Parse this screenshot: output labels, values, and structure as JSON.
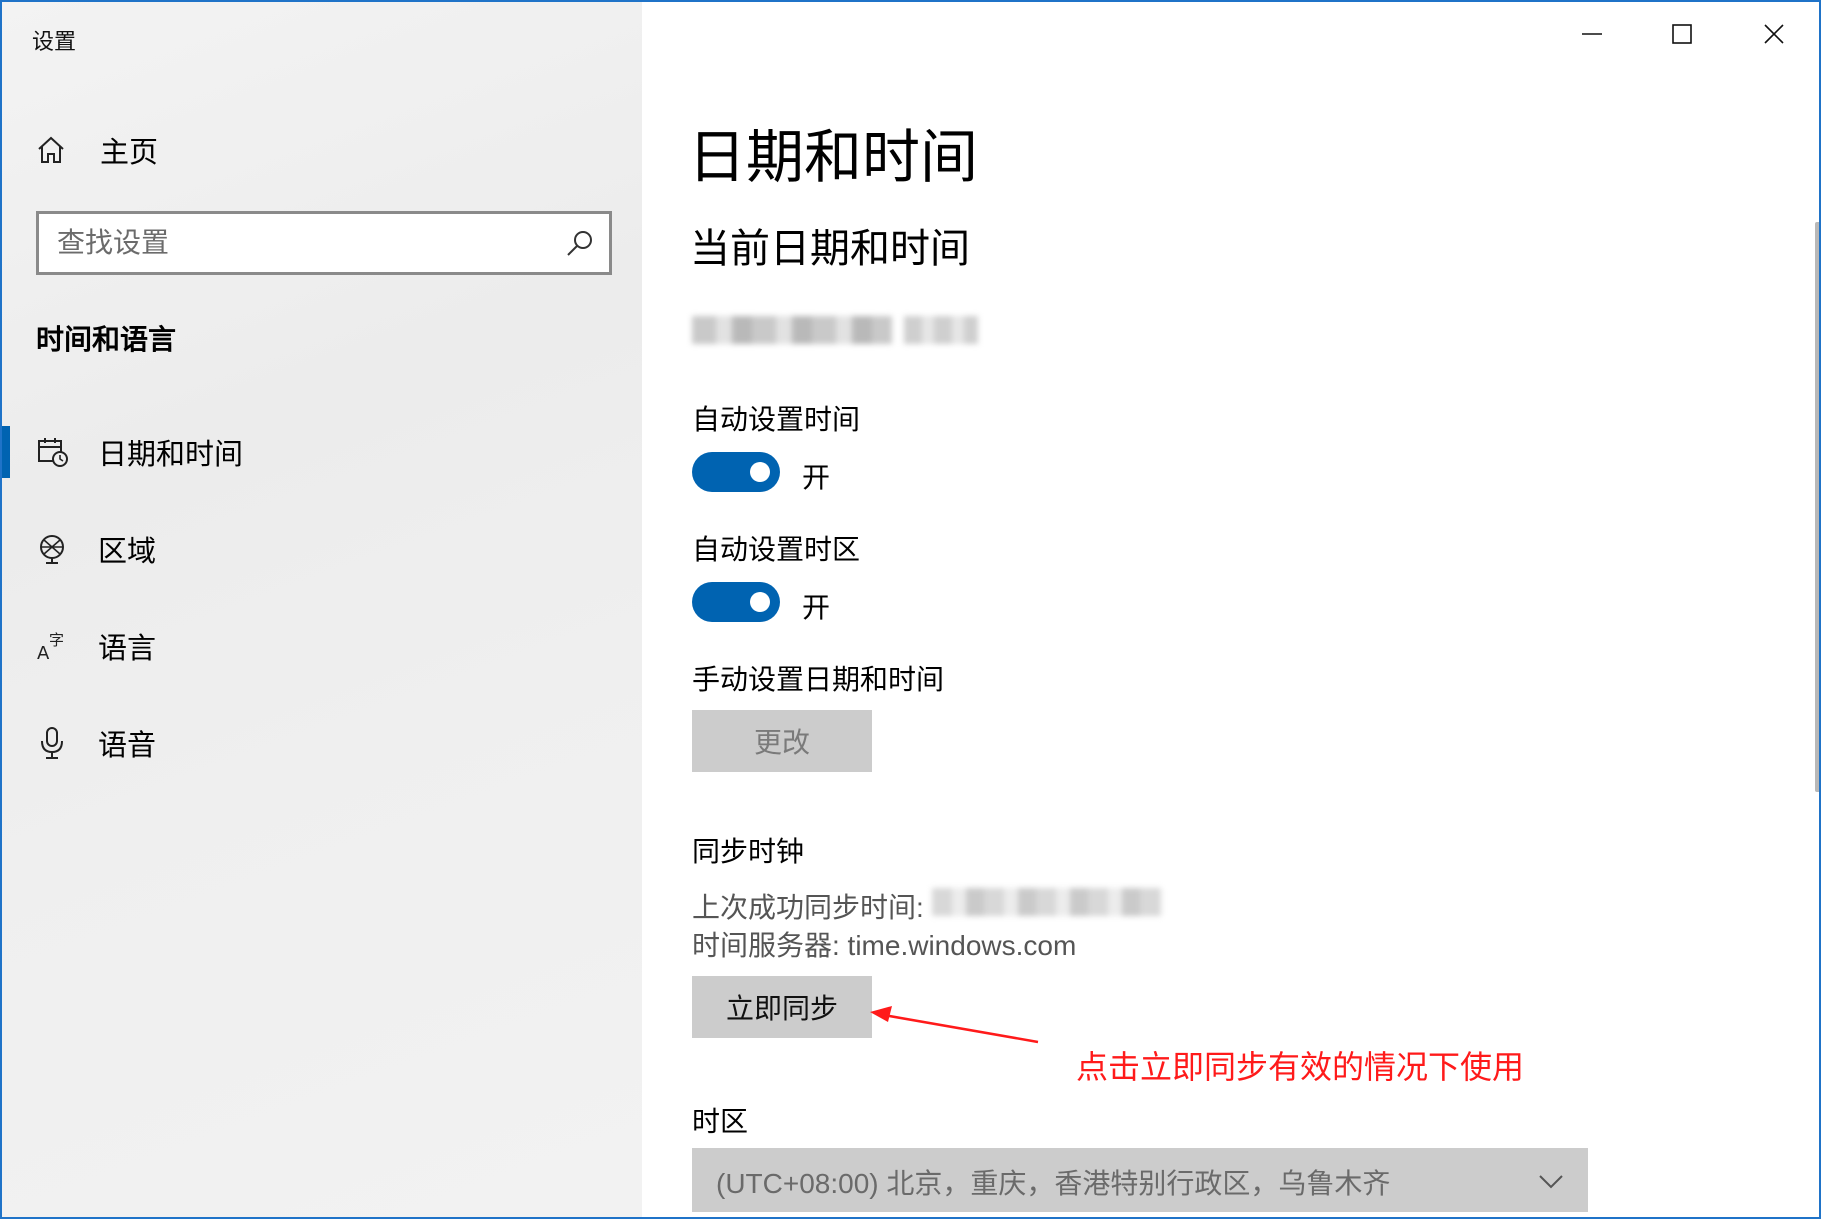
{
  "window": {
    "title": "设置",
    "controls": [
      "minimize-icon",
      "maximize-icon",
      "close-icon"
    ]
  },
  "sidebar": {
    "home": {
      "icon": "home-icon",
      "label": "主页"
    },
    "search": {
      "placeholder": "查找设置",
      "value": "",
      "icon": "search-icon"
    },
    "section_heading": "时间和语言",
    "items": [
      {
        "icon": "calendar-clock-icon",
        "label": "日期和时间",
        "active": true
      },
      {
        "icon": "globe-icon",
        "label": "区域",
        "active": false
      },
      {
        "icon": "language-icon",
        "label": "语言",
        "active": false
      },
      {
        "icon": "microphone-icon",
        "label": "语音",
        "active": false
      }
    ]
  },
  "main": {
    "title": "日期和时间",
    "current_heading": "当前日期和时间",
    "auto_time": {
      "label": "自动设置时间",
      "state": "开",
      "on": true
    },
    "auto_timezone": {
      "label": "自动设置时区",
      "state": "开",
      "on": true
    },
    "manual": {
      "label": "手动设置日期和时间",
      "button": "更改",
      "disabled": true
    },
    "sync": {
      "heading": "同步时钟",
      "last_sync_label": "上次成功同步时间: ",
      "time_server": "时间服务器: time.windows.com",
      "button": "立即同步"
    },
    "timezone": {
      "heading": "时区",
      "value": "(UTC+08:00) 北京，重庆，香港特别行政区，乌鲁木齐",
      "icon": "chevron-down-icon"
    }
  },
  "annotation": {
    "text": "点击立即同步有效的情况下使用",
    "color": "#ff1a1a"
  },
  "colors": {
    "accent": "#0063b1",
    "window_border": "#1f73c8"
  }
}
